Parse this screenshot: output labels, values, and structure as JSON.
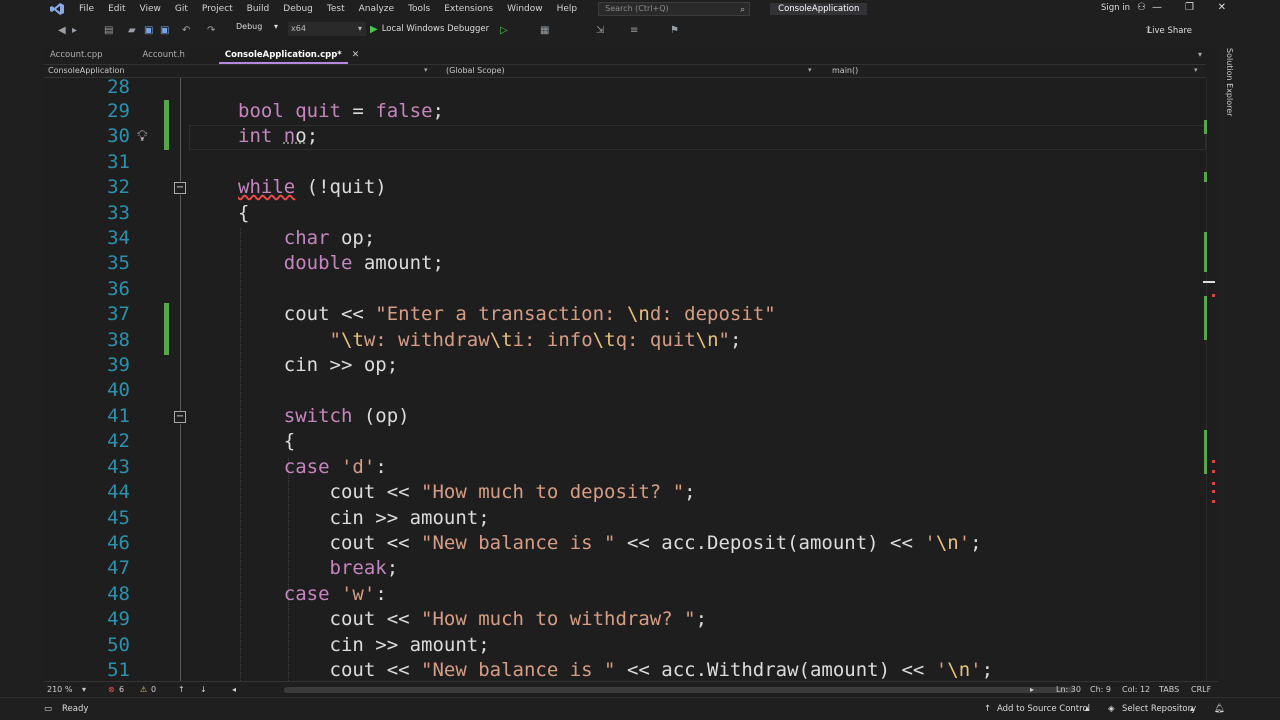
{
  "menu": {
    "items": [
      "File",
      "Edit",
      "View",
      "Git",
      "Project",
      "Build",
      "Debug",
      "Test",
      "Analyze",
      "Tools",
      "Extensions",
      "Window",
      "Help"
    ],
    "search_placeholder": "Search (Ctrl+Q)",
    "window_title": "ConsoleApplication",
    "signin": "Sign in"
  },
  "toolbar": {
    "configuration": "Debug",
    "platform": "x64",
    "run_label": "Local Windows Debugger",
    "live_share": "Live Share"
  },
  "tabs": [
    {
      "label": "Account.cpp"
    },
    {
      "label": "Account.h"
    },
    {
      "label": "ConsoleApplication.cpp*"
    }
  ],
  "navbar": {
    "project": "ConsoleApplication",
    "scope": "(Global Scope)",
    "member": "main()"
  },
  "side_panel": {
    "label": "Solution Explorer"
  },
  "editor": {
    "line_numbers": [
      "28",
      "29",
      "30",
      "31",
      "32",
      "33",
      "34",
      "35",
      "36",
      "37",
      "38",
      "39",
      "40",
      "41",
      "42",
      "43",
      "44",
      "45",
      "46",
      "47",
      "48",
      "49",
      "50",
      "51"
    ]
  },
  "editor_status": {
    "zoom": "210 %",
    "errors": "6",
    "warnings": "0",
    "ln": "Ln: 30",
    "ch": "Ch: 9",
    "col": "Col: 12",
    "tabs": "TABS",
    "eol": "CRLF"
  },
  "status": {
    "ready": "Ready",
    "source_control": "Add to Source Control",
    "repository": "Select Repository"
  },
  "colors": {
    "keyword": "#c586c0",
    "type": "#569cd6",
    "string": "#d69d85",
    "line_number": "#2b91af",
    "change_bar": "#57a64a"
  }
}
